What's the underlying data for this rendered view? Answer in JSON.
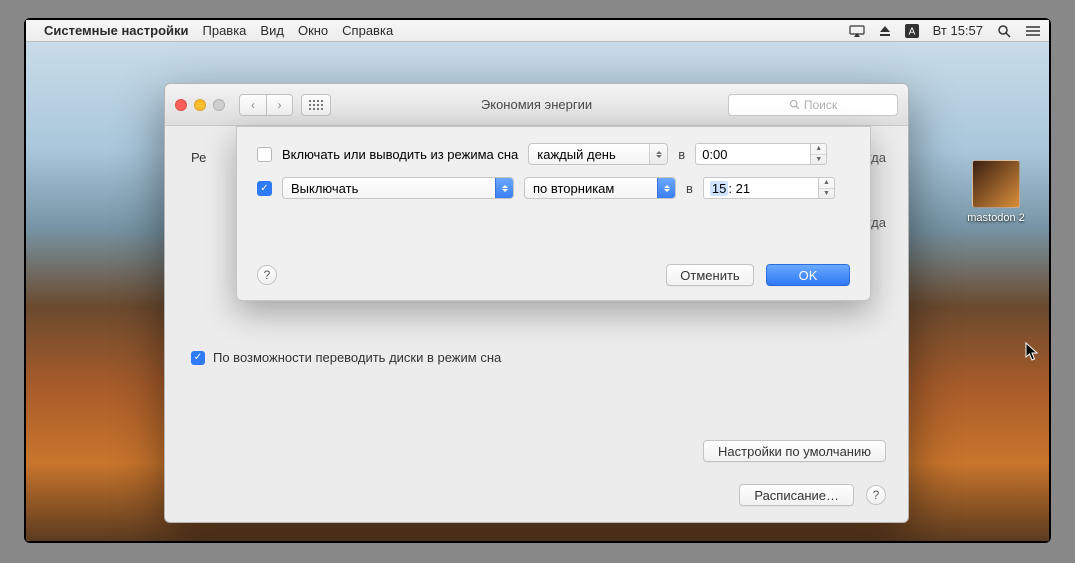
{
  "menubar": {
    "app": "Системные настройки",
    "items": [
      "Правка",
      "Вид",
      "Окно",
      "Справка"
    ],
    "clock": "Вт 15:57"
  },
  "desktop": {
    "file_label": "mastodon 2"
  },
  "window": {
    "title": "Экономия энергии",
    "search_placeholder": "Поиск",
    "partial_label": "Ре",
    "never1": "Никогда",
    "never2": "Никогда",
    "sleep_disks_label": "По возможности переводить диски в режим сна",
    "defaults_btn": "Настройки по умолчанию",
    "schedule_btn": "Расписание…"
  },
  "sheet": {
    "row1": {
      "checked": false,
      "label": "Включать или выводить из режима сна",
      "freq": "каждый день",
      "at": "в",
      "time": "0:00"
    },
    "row2": {
      "checked": true,
      "action": "Выключать",
      "freq": "по вторникам",
      "at": "в",
      "time_h": "15",
      "time_m": "21"
    },
    "cancel": "Отменить",
    "ok": "OK"
  }
}
